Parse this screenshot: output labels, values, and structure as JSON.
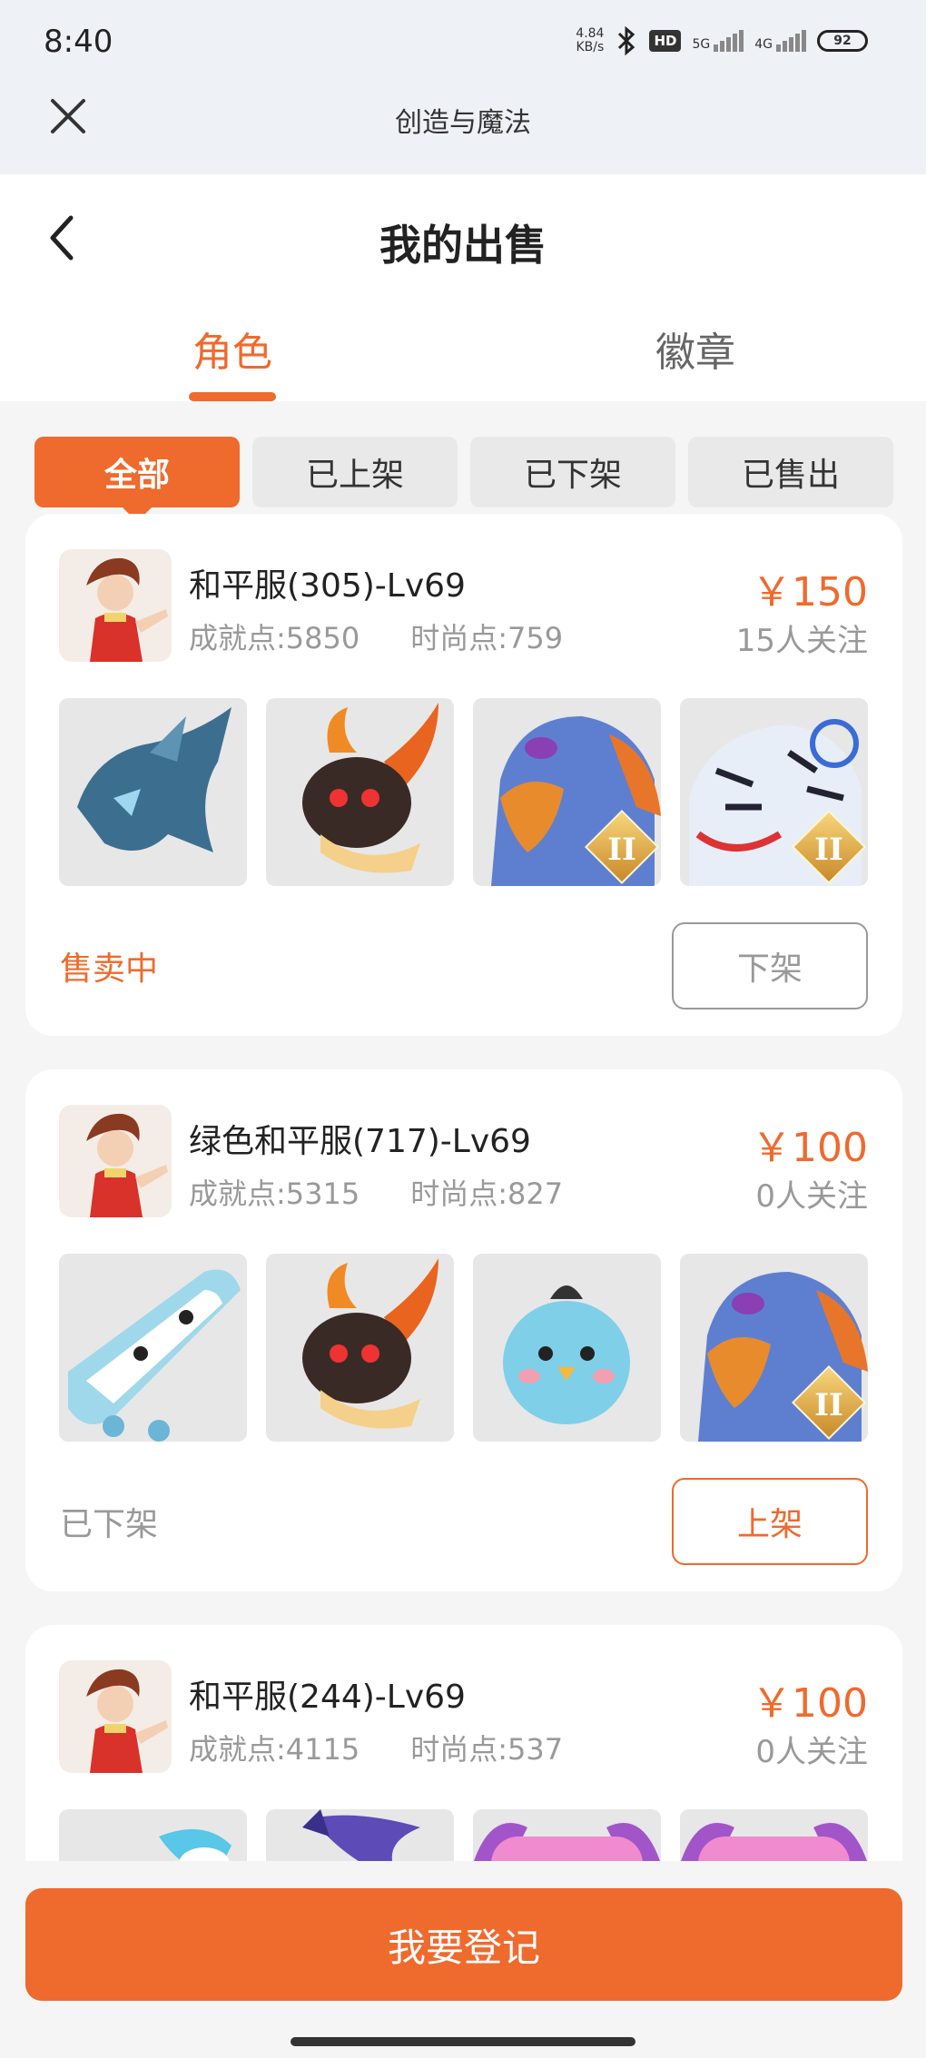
{
  "status_bar": {
    "time": "8:40",
    "speed_top": "4.84",
    "speed_bottom": "KB/s",
    "hd_label": "HD",
    "net1": "5G",
    "net2": "4G",
    "battery": "92"
  },
  "app_bar": {
    "title": "创造与魔法",
    "close_icon": "close-icon"
  },
  "header": {
    "title": "我的出售",
    "back_icon": "chevron-left-icon"
  },
  "tabs": [
    {
      "label": "角色",
      "active": true
    },
    {
      "label": "徽章",
      "active": false
    }
  ],
  "filters": [
    {
      "label": "全部",
      "active": true
    },
    {
      "label": "已上架",
      "active": false
    },
    {
      "label": "已下架",
      "active": false
    },
    {
      "label": "已售出",
      "active": false
    }
  ],
  "listings": [
    {
      "name": "和平服(305)-Lv69",
      "achievement": "成就点:5850",
      "fashion": "时尚点:759",
      "price": "￥150",
      "followers": "15人关注",
      "pets": [
        "ice-dragon",
        "fire-beast",
        "griffin-blue",
        "white-tiger"
      ],
      "status": "售卖中",
      "action": "下架"
    },
    {
      "name": "绿色和平服(717)-Lv69",
      "achievement": "成就点:5315",
      "fashion": "时尚点:827",
      "price": "￥100",
      "followers": "0人关注",
      "pets": [
        "bear-skateboard",
        "fire-beast",
        "blue-chick",
        "griffin-blue"
      ],
      "status": "已下架",
      "action": "上架"
    },
    {
      "name": "和平服(244)-Lv69",
      "achievement": "成就点:4115",
      "fashion": "时尚点:537",
      "price": "￥100",
      "followers": "0人关注",
      "pets": [
        "blue-mount",
        "purple-dragon",
        "pink-cat",
        "pink-cat"
      ]
    }
  ],
  "footer": {
    "register_label": "我要登记"
  },
  "badge_glyph": "II",
  "colors": {
    "accent": "#ef6a2d",
    "muted": "#999999"
  }
}
